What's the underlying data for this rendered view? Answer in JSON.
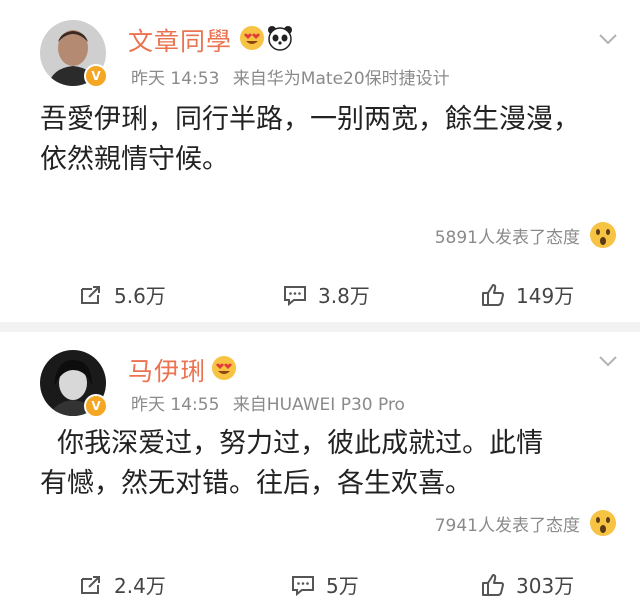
{
  "posts": [
    {
      "author": "文章同學",
      "time": "昨天 14:53",
      "source": "来自华为Mate20保时捷设计",
      "body_lines": [
        "吾愛伊琍，同行半路，一别两宽，餘生漫漫，",
        "依然親情守候。"
      ],
      "reaction_text": "5891人发表了态度",
      "actions": {
        "repost": "5.6万",
        "comment": "3.8万",
        "like": "149万"
      }
    },
    {
      "author": "马伊琍",
      "time": "昨天 14:55",
      "source": "来自HUAWEI P30 Pro",
      "body_lines": [
        "  你我深爱过，努力过，彼此成就过。此情",
        "有憾，然无对错。往后，各生欢喜。"
      ],
      "reaction_text": "7941人发表了态度",
      "actions": {
        "repost": "2.4万",
        "comment": "5万",
        "like": "303万"
      }
    }
  ],
  "icons": {
    "verified": "verified-badge-icon",
    "heart_eyes": "heart-eyes-emoji-icon",
    "panda": "panda-emoji-icon",
    "wow": "wow-emoji-icon",
    "chevron": "chevron-down-icon",
    "repost": "repost-icon",
    "comment": "comment-icon",
    "like": "thumbs-up-icon"
  },
  "colors": {
    "username": "#eb7350",
    "meta": "#8a8a8a",
    "verified": "#f5a623",
    "separator": "#f2f2f2"
  }
}
